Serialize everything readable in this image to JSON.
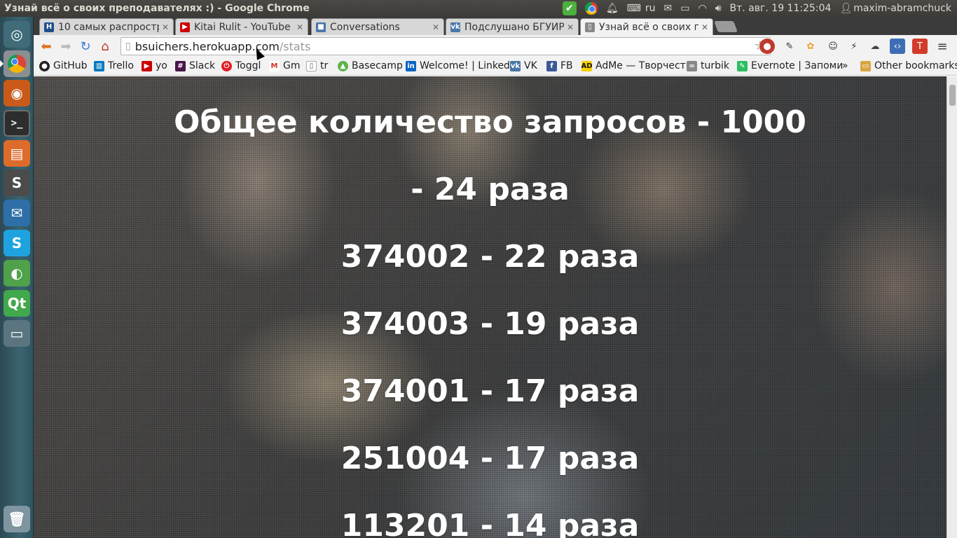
{
  "window_title": "Узнай всё о своих преподавателях :) - Google Chrome",
  "panel": {
    "keyboard_layout": "ru",
    "datetime": "Вт. авг. 19 11:25:04",
    "user": "maxim-abramchuck"
  },
  "tabs": [
    {
      "title": "10 самых распростра",
      "favicon": "H",
      "favicon_color": "#1f4e8c"
    },
    {
      "title": "Kitai Rulit - YouTube",
      "favicon": "▶",
      "favicon_color": "#cc0000"
    },
    {
      "title": "Conversations",
      "favicon": "■",
      "favicon_color": "#4a76a8"
    },
    {
      "title": "Подслушано БГУИР",
      "favicon": "vk",
      "favicon_color": "#4a76a8"
    },
    {
      "title": "Узнай всё о своих пр",
      "favicon": "▯",
      "favicon_color": "#888888"
    }
  ],
  "url": {
    "host": "bsuichers.herokuapp.com",
    "path": "/stats"
  },
  "bookmarks": [
    {
      "label": "GitHub",
      "icon": "github-icon",
      "color": "#222222"
    },
    {
      "label": "Trello",
      "icon": "trello-icon",
      "color": "#0079bf"
    },
    {
      "label": "yo",
      "icon": "youtube-icon",
      "color": "#cc0000"
    },
    {
      "label": "Slack",
      "icon": "slack-icon",
      "color": "#4a154b"
    },
    {
      "label": "Toggl",
      "icon": "toggl-icon",
      "color": "#e01b22"
    },
    {
      "label": "Gm",
      "icon": "gmail-icon",
      "color": "#d93025"
    },
    {
      "label": "tr",
      "icon": "translate-icon",
      "color": "#555555"
    },
    {
      "label": "Basecamp",
      "icon": "basecamp-icon",
      "color": "#5eb44e"
    },
    {
      "label": "Welcome! | Linked",
      "icon": "linkedin-icon",
      "color": "#0a66c2"
    },
    {
      "label": "VK",
      "icon": "vk-icon",
      "color": "#4a76a8"
    },
    {
      "label": "FB",
      "icon": "facebook-icon",
      "color": "#3b5998"
    },
    {
      "label": "AdMe — Творчест",
      "icon": "adme-icon",
      "color": "#222222"
    },
    {
      "label": "turbik",
      "icon": "turbik-icon",
      "color": "#777777"
    },
    {
      "label": "Evernote | Запоми",
      "icon": "evernote-icon",
      "color": "#2dbe60"
    },
    {
      "label": "»",
      "icon": "more-icon",
      "color": "#333333"
    },
    {
      "label": "Other bookmarks",
      "icon": "folder-icon",
      "color": "#d8a742"
    }
  ],
  "page": {
    "heading": "Общее количество запросов - 1000",
    "stats": [
      " - 24 раза",
      "374002 - 22 раза",
      "374003 - 19 раза",
      "374001 - 17 раза",
      "251004 - 17 раза",
      "113201 - 14 раза"
    ]
  }
}
